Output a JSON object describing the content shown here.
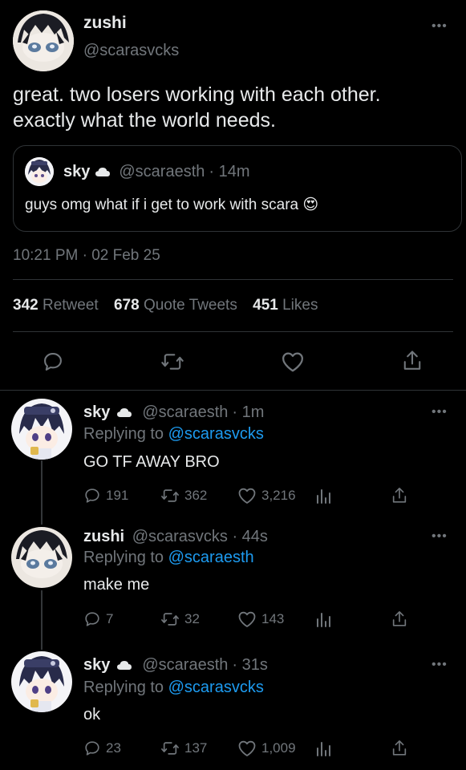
{
  "main_tweet": {
    "display_name": "zushi",
    "handle": "@scarasvcks",
    "text_line1": "great. two losers working with each other.",
    "text_line2": "exactly what the world needs.",
    "timestamp": "10:21 PM · 02 Feb 25",
    "more_icon": "more-horizontal-icon",
    "quoted": {
      "display_name": "sky",
      "cloud_icon": "cloud-icon",
      "handle": "@scaraesth",
      "time": "· 14m",
      "text": "guys omg what if i get to work with scara",
      "emoji": "😍"
    },
    "stats": {
      "retweets_count": "342",
      "retweets_label": "Retweet",
      "quotes_count": "678",
      "quotes_label": "Quote Tweets",
      "likes_count": "451",
      "likes_label": "Likes"
    },
    "action_icons": [
      "reply-icon",
      "retweet-icon",
      "like-icon",
      "share-icon"
    ]
  },
  "replies": [
    {
      "display_name": "sky",
      "handle": "@scaraesth",
      "time": "· 1m",
      "replying_prefix": "Replying to",
      "replying_to": "@scarasvcks",
      "text": "GO TF AWAY BRO",
      "reply_count": "191",
      "retweet_count": "362",
      "like_count": "3,216"
    },
    {
      "display_name": "zushi",
      "handle": "@scarasvcks",
      "time": "· 44s",
      "replying_prefix": "Replying to",
      "replying_to": "@scaraesth",
      "text": "make me",
      "reply_count": "7",
      "retweet_count": "32",
      "like_count": "143"
    },
    {
      "display_name": "sky",
      "handle": "@scaraesth",
      "time": "· 31s",
      "replying_prefix": "Replying to",
      "replying_to": "@scarasvcks",
      "text": "ok",
      "reply_count": "23",
      "retweet_count": "137",
      "like_count": "1,009"
    }
  ],
  "colors": {
    "background": "#000000",
    "text": "#e7e9ea",
    "muted": "#71767b",
    "link": "#1d9bf0",
    "divider": "#2f3336"
  }
}
